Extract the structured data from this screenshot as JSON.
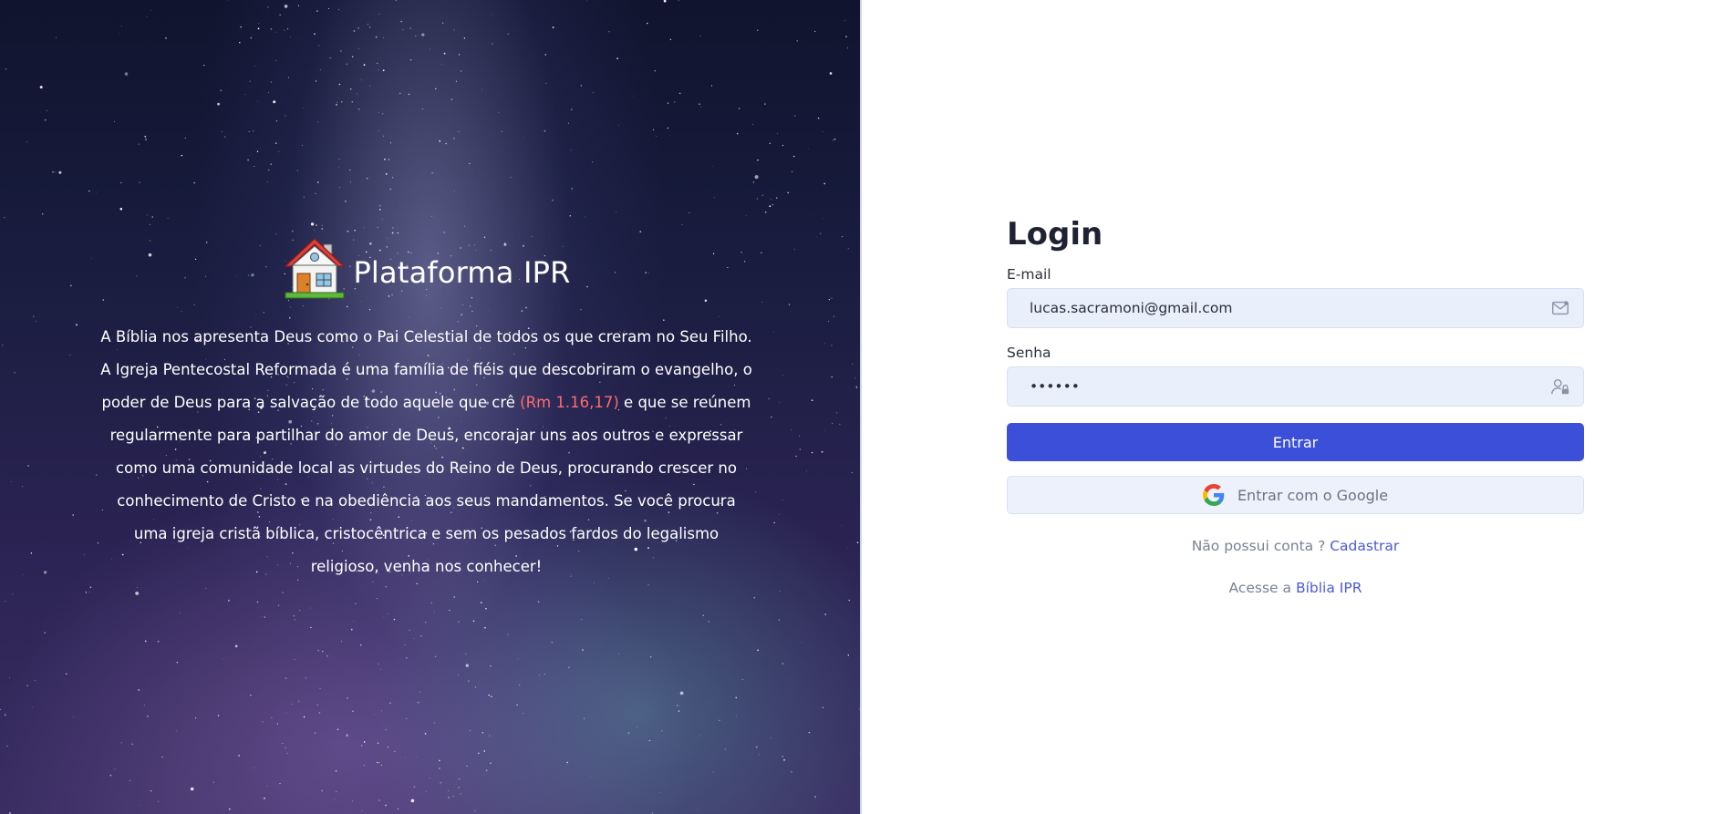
{
  "hero": {
    "brand_title": "Plataforma IPR",
    "logo_icon": "house-icon",
    "text_before_verse": "A Bíblia nos apresenta Deus como o Pai Celestial de todos os que creram no Seu Filho. A Igreja Pentecostal Reformada é uma família de fiéis que descobriram o evangelho, o poder de Deus para a salvação de todo aquele que crê ",
    "verse_ref": "(Rm 1.16,17)",
    "text_after_verse": " e que se reúnem regularmente para partilhar do amor de Deus, encorajar uns aos outros e expressar como uma comunidade local as virtudes do Reino de Deus, procurando crescer no conhecimento de Cristo e na obediência aos seus mandamentos. Se você procura uma igreja cristã bíblica, cristocêntrica e sem os pesados fardos do legalismo religioso, venha nos conhecer!",
    "verse_color": "#ff6b6b"
  },
  "login": {
    "title": "Login",
    "email_label": "E-mail",
    "email_value": "lucas.sacramoni@gmail.com",
    "email_icon": "mail-icon",
    "password_label": "Senha",
    "password_value": "••••••",
    "password_icon": "user-lock-icon",
    "submit_label": "Entrar",
    "google_label": "Entrar com o Google",
    "google_icon": "google-icon",
    "signup_prompt": "Não possui conta ? ",
    "signup_link": "Cadastrar",
    "bible_prompt": "Acesse a ",
    "bible_link": "Bíblia IPR"
  },
  "colors": {
    "primary": "#3b4fd8",
    "link": "#4b5bd6",
    "input_bg": "#e9effb"
  }
}
